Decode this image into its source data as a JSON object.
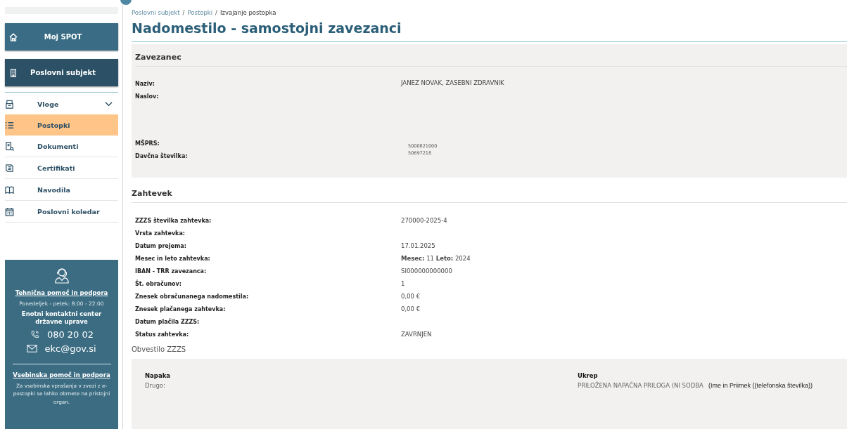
{
  "sidebar": {
    "top_buttons": [
      {
        "label": "Moj SPOT",
        "selected": false
      },
      {
        "label": "Poslovni subjekt",
        "selected": true
      }
    ],
    "items": [
      {
        "label": "Vloge",
        "kind": "dropdown",
        "expanded": false,
        "selected": false
      },
      {
        "label": "Postopki",
        "kind": "link",
        "selected": true
      },
      {
        "label": "Dokumenti",
        "kind": "link",
        "selected": false
      },
      {
        "label": "Certifikati",
        "kind": "link",
        "selected": false
      },
      {
        "label": "Navodila",
        "kind": "link",
        "selected": false
      },
      {
        "label": "Poslovni koledar",
        "kind": "link",
        "selected": false
      }
    ],
    "help": {
      "title": "Tehnična pomoč in podpora",
      "hours": "Ponedeljek - petek: 8:00 - 22:00",
      "center": "Enotni kontaktni center državne uprave",
      "phone": "080 20 02",
      "email": "ekc@gov.si",
      "content_title": "Vsebinska pomoč in podpora",
      "content_text": "Za vsebinska vprašanja v zvezi z e-postopki se lahko obrnete na pristojni organ."
    }
  },
  "breadcrumb": [
    {
      "label": "Poslovni subjekt"
    },
    {
      "separator": "/",
      "label": "Postopki"
    },
    {
      "separator": "/",
      "label": "Izvajanje postopka"
    }
  ],
  "title": "Nadomestilo - samostojni zavezanci",
  "zavezanec": {
    "heading": "Zavezanec",
    "naziv_label": "Naziv:",
    "naslov_label": "Naslov:",
    "naziv_value": "JANEZ NOVAK, ZASEBNI ZDRAVNIK",
    "msprs_label": "MŠPRS:",
    "davcna_label": "Davčna številka:",
    "msprs_value": "5000821000",
    "davcna_value": "50697218"
  },
  "zahtevek": {
    "heading": "Zahtevek",
    "rows": [
      {
        "label": "ZZZS številka zahtevka:",
        "value": "270000-2025-4"
      },
      {
        "label": "Vrsta zahtevka:"
      },
      {
        "label": "Datum prejema:",
        "value": "17.01.2025"
      },
      {
        "label": "Mesec in leto zahtevka:",
        "value": "**Mesec:** 11   **Leto:** 2024"
      },
      {
        "label": "IBAN - TRR zavezanca:",
        "value": "SI000000000000"
      },
      {
        "label": "Št. obračunov:",
        "value": "1"
      },
      {
        "label": "Znesek obračunanega nadomestila:",
        "value": "0,00 €"
      },
      {
        "label": "Znesek plačanega zahtevka:",
        "value": "0,00 €"
      },
      {
        "label": "Datum plačila ZZZS:"
      },
      {
        "label": "Status zahtevka:",
        "value": "ZAVRNJEN"
      }
    ]
  },
  "obvestilo": {
    "heading": "Obvestilo ZZZS",
    "napaka_label": "Napaka",
    "napaka_value": "Drugo:",
    "ukrep_label": "Ukrep",
    "ukrep_value": "PRILOŽENA NAPAČNA PRILOGA (NI SODBA",
    "ukrep_note": "(Ime in Priimek ((telefonska številka))"
  }
}
